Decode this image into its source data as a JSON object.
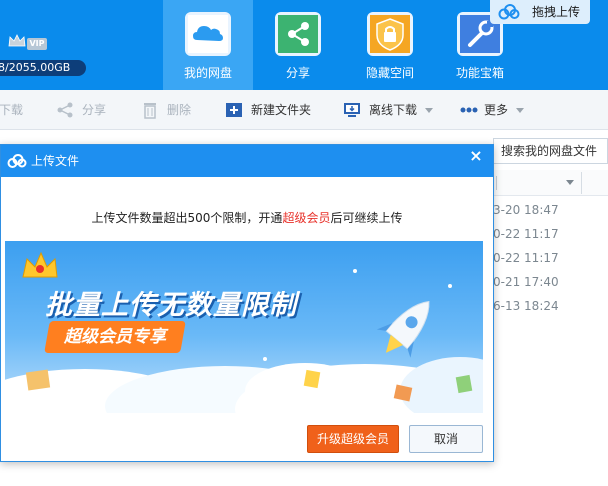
{
  "header": {
    "vip_label": "VIP",
    "storage": "8/2055.00GB",
    "tabs": [
      {
        "label": "我的网盘",
        "icon": "cloud-drive-icon",
        "active": true
      },
      {
        "label": "分享",
        "icon": "share-icon",
        "active": false
      },
      {
        "label": "隐藏空间",
        "icon": "lock-icon",
        "active": false
      },
      {
        "label": "功能宝箱",
        "icon": "tools-icon",
        "active": false
      }
    ],
    "drag_upload": "拖拽上传"
  },
  "toolbar": {
    "download": "下载",
    "share": "分享",
    "delete": "删除",
    "new_folder": "新建文件夹",
    "offline_download": "离线下载",
    "more": "更多"
  },
  "file_list": {
    "search_placeholder": "搜索我的网盘文件",
    "dates": [
      "3-20 18:47",
      "0-22 11:17",
      "0-22 11:17",
      "0-21 17:40",
      "6-13 18:24"
    ]
  },
  "dialog": {
    "title": "上传文件",
    "message_before": "上传文件数量超出500个限制，开通",
    "message_highlight": "超级会员",
    "message_after": "后可继续上传",
    "banner_title": "批量上传无数量限制",
    "banner_tag": "超级会员专享",
    "upgrade_button": "升级超级会员",
    "cancel_button": "取消"
  },
  "colors": {
    "header_blue": "#0a8bec",
    "active_tab": "#3aa6f4",
    "dialog_head": "#1e8ff0",
    "highlight_red": "#e8322b",
    "upgrade_orange": "#f0611a"
  }
}
